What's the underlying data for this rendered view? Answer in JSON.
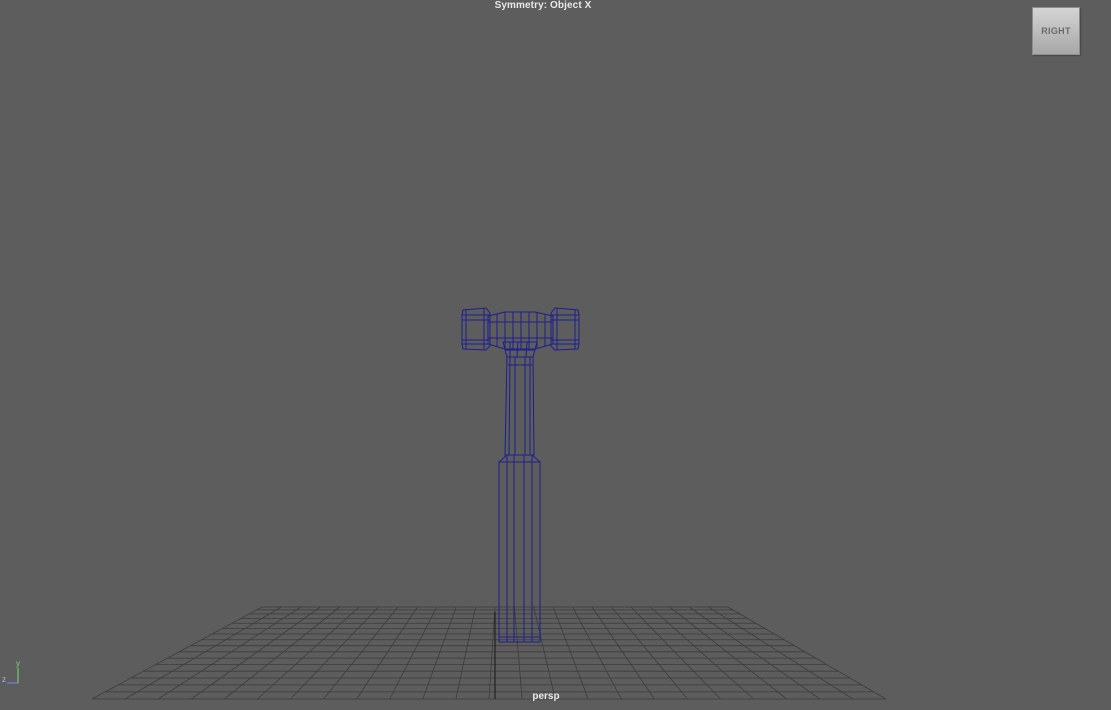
{
  "viewport": {
    "symmetry_label": "Symmetry: Object X",
    "camera_label": "persp",
    "background": "#5d5d5d"
  },
  "viewcube": {
    "face_label": "RIGHT"
  },
  "axis_indicator": {
    "y_label": "y",
    "z_label": "z",
    "y_color": "#6fe06f",
    "z_color": "#6f8cff"
  },
  "scene": {
    "grid_color": "#3a3a3a",
    "wireframe_color": "#1a1a8c"
  }
}
